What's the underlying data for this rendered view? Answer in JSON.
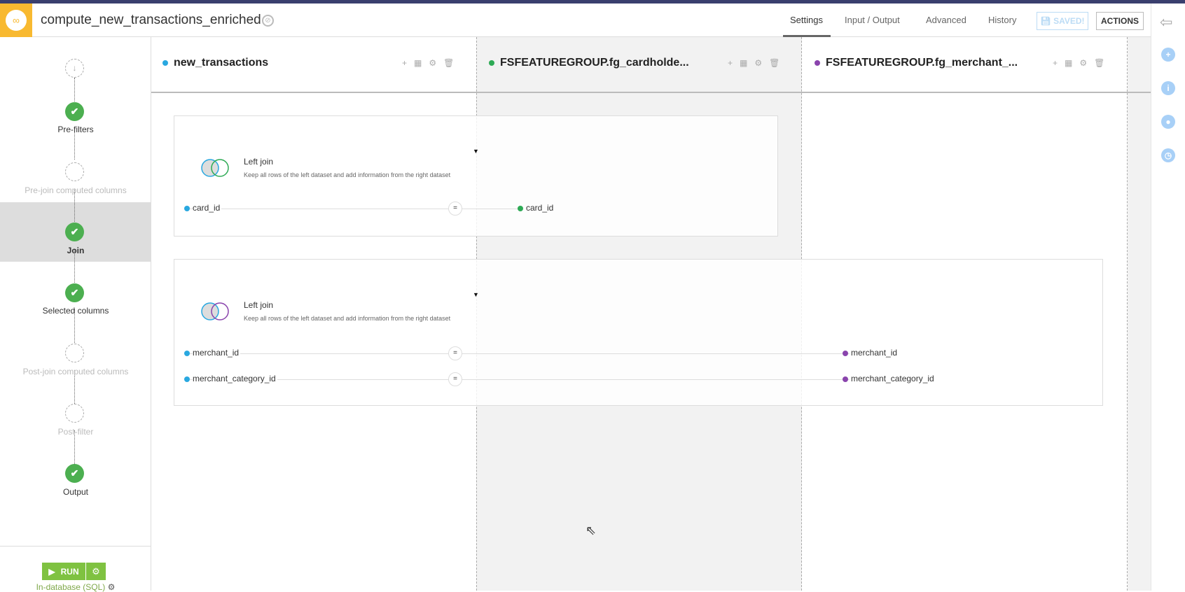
{
  "header": {
    "title": "compute_new_transactions_enriched",
    "tabs": [
      "Settings",
      "Input / Output",
      "Advanced",
      "History"
    ],
    "active_tab": "Settings",
    "saved_label": "SAVED!",
    "actions_label": "ACTIONS"
  },
  "sidebar": {
    "steps": [
      {
        "label": "",
        "state": "start"
      },
      {
        "label": "Pre-filters",
        "state": "done"
      },
      {
        "label": "Pre-join computed columns",
        "state": "empty"
      },
      {
        "label": "Join",
        "state": "done",
        "active": true
      },
      {
        "label": "Selected columns",
        "state": "done"
      },
      {
        "label": "Post-join computed columns",
        "state": "empty"
      },
      {
        "label": "Post-filter",
        "state": "empty"
      },
      {
        "label": "Output",
        "state": "done"
      }
    ],
    "run_label": "RUN",
    "engine_label": "In-database (SQL)"
  },
  "datasets": [
    {
      "name": "new_transactions",
      "color": "#29a8e0"
    },
    {
      "name": "FSFEATUREGROUP.fg_cardholde...",
      "color": "#2eaa55"
    },
    {
      "name": "FSFEATUREGROUP.fg_merchant_...",
      "color": "#8a44ad"
    }
  ],
  "joins": [
    {
      "type": "Left join",
      "description": "Keep all rows of the left dataset and add information from the right dataset",
      "right_color": "#2eaa55",
      "conditions": [
        {
          "left": "card_id",
          "op": "=",
          "right": "card_id"
        }
      ]
    },
    {
      "type": "Left join",
      "description": "Keep all rows of the left dataset and add information from the right dataset",
      "right_color": "#8a44ad",
      "conditions": [
        {
          "left": "merchant_id",
          "op": "=",
          "right": "merchant_id"
        },
        {
          "left": "merchant_category_id",
          "op": "=",
          "right": "merchant_category_id"
        }
      ]
    }
  ]
}
